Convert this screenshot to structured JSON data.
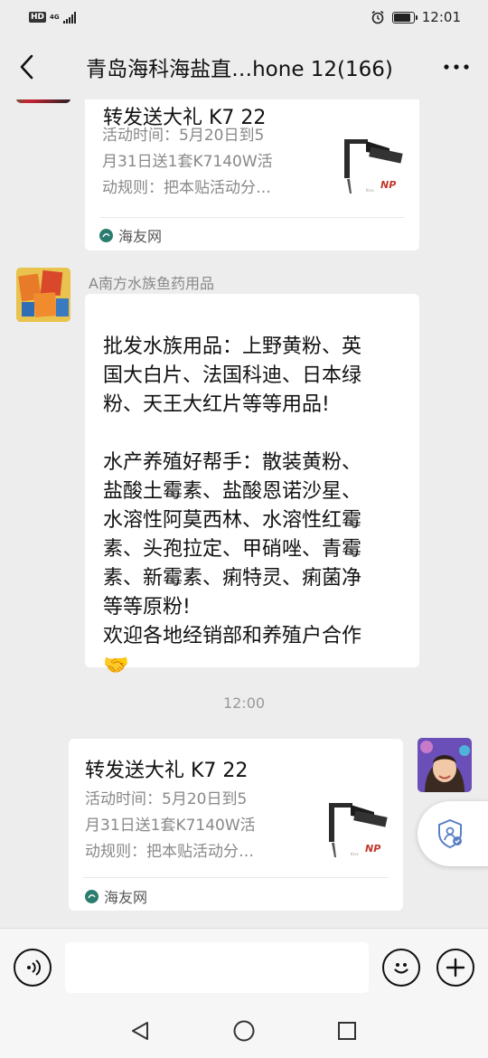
{
  "status_bar": {
    "hd": "HD",
    "network": "4G",
    "time": "12:01"
  },
  "header": {
    "title": "青岛海科海盐直…hone 12(166)"
  },
  "messages": {
    "card_top": {
      "title": "转发送大礼 K7 22",
      "desc": "活动时间：5月20日到5\n月31日送1套K7140W活\n动规则：把本贴活动分…",
      "source": "海友网"
    },
    "msg1": {
      "sender": "A南方水族鱼药用品",
      "text": "批发水族用品：上野黄粉、英\n国大白片、法国科迪、日本绿\n粉、天王大红片等等用品!\n\n水产养殖好帮手：散装黄粉、\n盐酸土霉素、盐酸恩诺沙星、\n水溶性阿莫西林、水溶性红霉\n素、头孢拉定、甲硝唑、青霉\n素、新霉素、痢特灵、痢菌净\n等等原粉!\n欢迎各地经销部和养殖户合作",
      "emoji": "🤝"
    },
    "timestamp": "12:00",
    "card_bottom": {
      "title": "转发送大礼 K7 22",
      "desc": "活动时间：5月20日到5\n月31日送1套K7140W活\n动规则：把本贴活动分…",
      "source": "海友网"
    }
  },
  "colors": {
    "background": "#ededed",
    "bubble": "#ffffff",
    "secondary_text": "#888888",
    "shield_accent": "#5a7fc4"
  }
}
